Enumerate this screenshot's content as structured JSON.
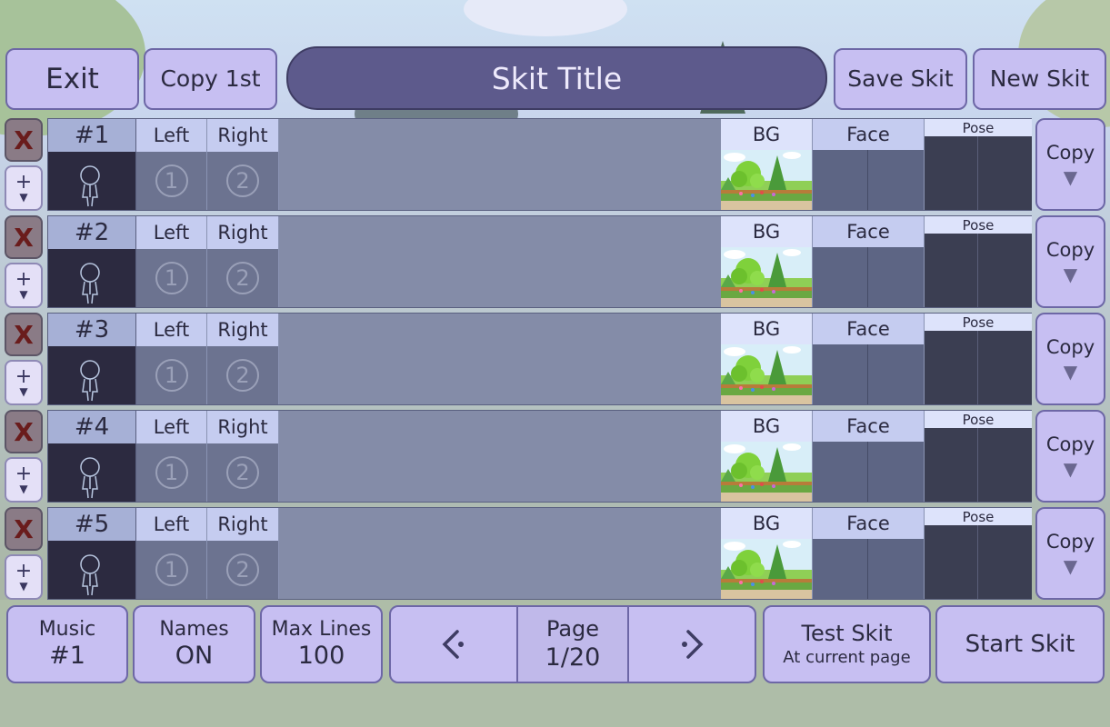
{
  "header": {
    "exit_label": "Exit",
    "copy_first_label": "Copy 1st",
    "title": "Skit Title",
    "save_label": "Save Skit",
    "new_label": "New Skit"
  },
  "rows": [
    {
      "number": "#1",
      "left": "Left",
      "right": "Right",
      "left_slot": "1",
      "right_slot": "2",
      "bg": "BG",
      "face": "Face",
      "pose": "Pose",
      "copy": "Copy",
      "delete": "X",
      "add": "+"
    },
    {
      "number": "#2",
      "left": "Left",
      "right": "Right",
      "left_slot": "1",
      "right_slot": "2",
      "bg": "BG",
      "face": "Face",
      "pose": "Pose",
      "copy": "Copy",
      "delete": "X",
      "add": "+"
    },
    {
      "number": "#3",
      "left": "Left",
      "right": "Right",
      "left_slot": "1",
      "right_slot": "2",
      "bg": "BG",
      "face": "Face",
      "pose": "Pose",
      "copy": "Copy",
      "delete": "X",
      "add": "+"
    },
    {
      "number": "#4",
      "left": "Left",
      "right": "Right",
      "left_slot": "1",
      "right_slot": "2",
      "bg": "BG",
      "face": "Face",
      "pose": "Pose",
      "copy": "Copy",
      "delete": "X",
      "add": "+"
    },
    {
      "number": "#5",
      "left": "Left",
      "right": "Right",
      "left_slot": "1",
      "right_slot": "2",
      "bg": "BG",
      "face": "Face",
      "pose": "Pose",
      "copy": "Copy",
      "delete": "X",
      "add": "+"
    }
  ],
  "footer": {
    "music_label": "Music",
    "music_value": "#1",
    "names_label": "Names",
    "names_value": "ON",
    "max_lines_label": "Max Lines",
    "max_lines_value": "100",
    "page_label": "Page",
    "page_value": "1/20",
    "test_label": "Test Skit",
    "test_sub": "At current page",
    "start_label": "Start Skit"
  },
  "colors": {
    "button": "#c7bff2",
    "title_pill": "#5d5a8c",
    "delete_x": "#6a1c1c"
  }
}
